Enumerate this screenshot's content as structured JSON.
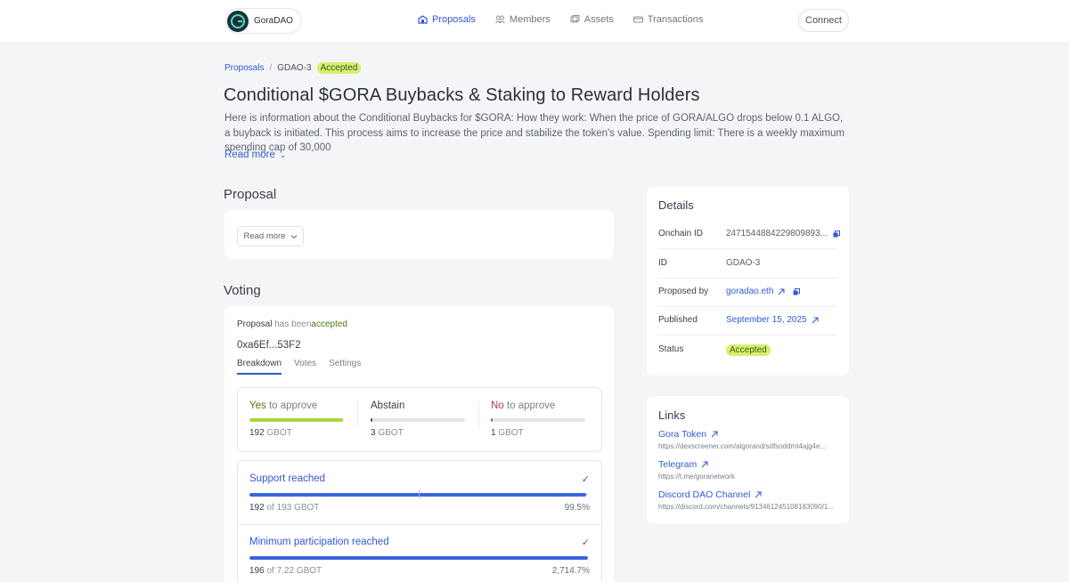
{
  "header": {
    "brand": "GoraDAO",
    "nav": [
      {
        "label": "Proposals",
        "icon": "proposals-icon"
      },
      {
        "label": "Members",
        "icon": "members-icon"
      },
      {
        "label": "Assets",
        "icon": "assets-icon"
      },
      {
        "label": "Transactions",
        "icon": "transactions-icon"
      }
    ],
    "connect_label": "Connect"
  },
  "breadcrumb": {
    "root": "Proposals",
    "sep": "/",
    "current": "GDAO-3",
    "badge": "Accepted"
  },
  "proposal": {
    "title": "Conditional $GORA Buybacks & Staking to Reward Holders",
    "description": "Here is information about the Conditional Buybacks for $GORA: How they work: When the price of GORA/ALGO drops below 0.1 ALGO, a buyback is initiated. This process aims to increase the price and stabilize the token's value. Spending limit: There is a weekly maximum spending cap of 30,000",
    "read_more": "Read more",
    "section_title": "Proposal",
    "card_read_more": "Read more"
  },
  "voting": {
    "section_title": "Voting",
    "status_prefix": "Proposal",
    "status_middle": "has been",
    "status_word": "accepted",
    "address": "0xa6Ef...53F2",
    "tabs": [
      "Breakdown",
      "Votes",
      "Settings"
    ],
    "breakdown": [
      {
        "strong": "Yes",
        "rest": "to approve",
        "value": "192",
        "unit": "GBOT",
        "fraction": 0.995,
        "color": "#a3d93a"
      },
      {
        "strong": "Abstain",
        "rest": "",
        "value": "3",
        "unit": "GBOT",
        "fraction": 0.016,
        "color": "#3a3f4b"
      },
      {
        "strong": "No",
        "rest": "to approve",
        "value": "1",
        "unit": "GBOT",
        "fraction": 0.005,
        "color": "#d64545"
      }
    ],
    "support": {
      "title": "Support reached",
      "value": "192",
      "of_text": "of 193 GBOT",
      "percent": "99.5%",
      "fraction": 0.995,
      "threshold": 0.5
    },
    "participation": {
      "title": "Minimum participation reached",
      "value": "196",
      "of_text": "of 7.22 GBOT",
      "percent": "2,714.7%",
      "fraction": 1.0
    }
  },
  "details": {
    "title": "Details",
    "rows": [
      {
        "label": "Onchain ID",
        "value": "2471544884229809893..."
      },
      {
        "label": "ID",
        "value": "GDAO-3"
      },
      {
        "label": "Proposed by",
        "value": "goradao.eth"
      },
      {
        "label": "Published",
        "value": "September 15, 2025"
      },
      {
        "label": "Status",
        "value": "Accepted"
      }
    ]
  },
  "links": {
    "title": "Links",
    "items": [
      {
        "title": "Gora Token",
        "url": "https://dexscreener.com/algorand/sdfsoddmt4ajg4e..."
      },
      {
        "title": "Telegram",
        "url": "https://t.me/goranetwork"
      },
      {
        "title": "Discord DAO Channel",
        "url": "https://discord.com/channels/913461245108183090/1..."
      }
    ]
  },
  "colors": {
    "accent": "#3358d4",
    "badge": "#d5f070",
    "support_bar": "#3a64e0"
  }
}
